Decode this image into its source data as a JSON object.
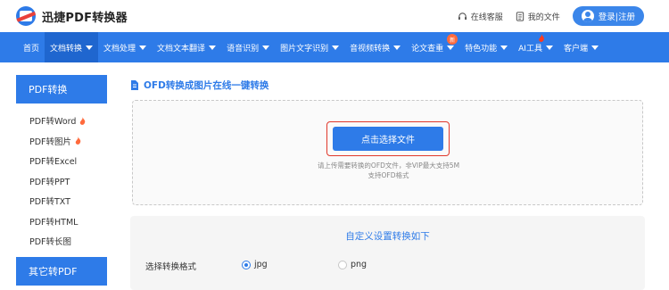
{
  "header": {
    "logo_text": "迅捷PDF转换器",
    "service_label": "在线客服",
    "files_label": "我的文件",
    "login_label": "登录|注册"
  },
  "nav": {
    "items": [
      {
        "label": "首页",
        "dropdown": false
      },
      {
        "label": "文档转换",
        "dropdown": true,
        "active": true
      },
      {
        "label": "文档处理",
        "dropdown": true
      },
      {
        "label": "文档文本翻译",
        "dropdown": true
      },
      {
        "label": "语音识别",
        "dropdown": true
      },
      {
        "label": "图片文字识别",
        "dropdown": true
      },
      {
        "label": "音视频转换",
        "dropdown": true
      },
      {
        "label": "论文查重",
        "dropdown": true,
        "badge": "新"
      },
      {
        "label": "特色功能",
        "dropdown": true
      },
      {
        "label": "AI工具",
        "dropdown": true,
        "hot": true
      },
      {
        "label": "客户端",
        "dropdown": true
      }
    ]
  },
  "sidebar": {
    "section1_title": "PDF转换",
    "items": [
      {
        "label": "PDF转Word",
        "hot": true
      },
      {
        "label": "PDF转图片",
        "hot": true
      },
      {
        "label": "PDF转Excel",
        "hot": false
      },
      {
        "label": "PDF转PPT",
        "hot": false
      },
      {
        "label": "PDF转TXT",
        "hot": false
      },
      {
        "label": "PDF转HTML",
        "hot": false
      },
      {
        "label": "PDF转长图",
        "hot": false
      }
    ],
    "section2_title": "其它转PDF"
  },
  "main": {
    "title": "OFD转换成图片在线一键转换",
    "upload_button": "点击选择文件",
    "hint_line1": "请上传需要转换的OFD文件，非VIP最大支持5M",
    "hint_line2": "支持OFD格式",
    "settings_title": "自定义设置转换如下",
    "format_label": "选择转换格式",
    "options": [
      {
        "label": "jpg",
        "selected": true
      },
      {
        "label": "png",
        "selected": false
      }
    ]
  },
  "colors": {
    "primary": "#2e7be8",
    "nav_active": "#1f66cf",
    "highlight": "#e0382b",
    "hot": "#ff6a3c"
  }
}
